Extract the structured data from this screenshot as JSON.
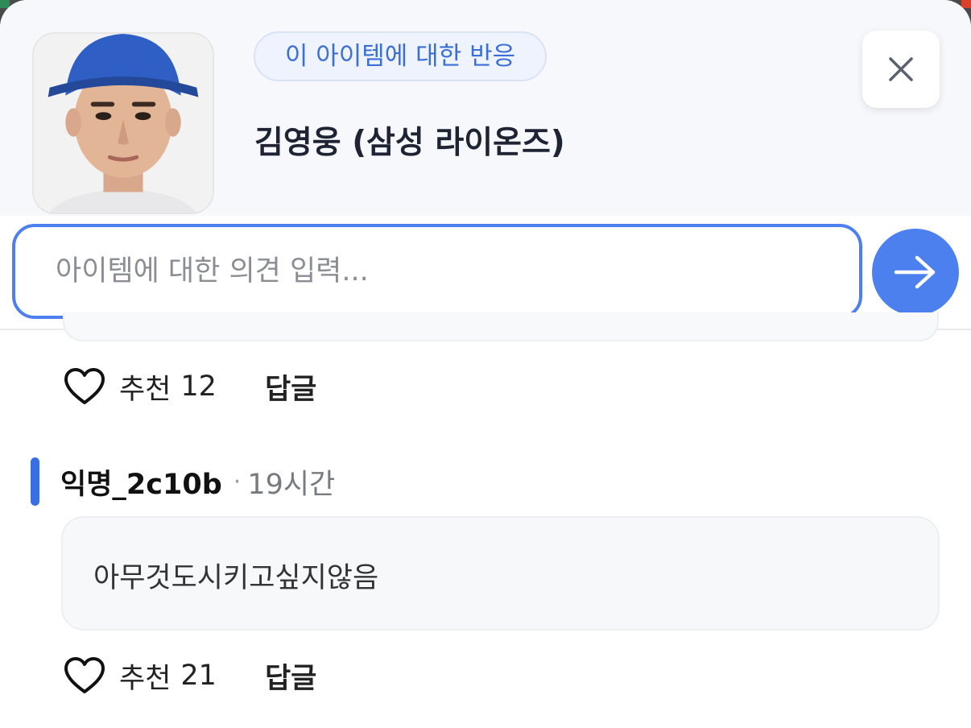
{
  "header": {
    "badge": "이 아이템에 대한 반응",
    "player_name": "김영웅 (삼성 라이온즈)",
    "avatar_alt": "player photo",
    "close_icon": "close-icon"
  },
  "composer": {
    "placeholder": "아이템에 대한 의견 입력...",
    "send_icon": "arrow-right-icon"
  },
  "comments": [
    {
      "like_label": "추천",
      "like_count": "12",
      "reply_label": "답글"
    },
    {
      "author": "익명_2c10b",
      "separator": "·",
      "time": "19시간",
      "body": "아무것도시키고싶지않음",
      "like_label": "추천",
      "like_count": "21",
      "reply_label": "답글"
    }
  ],
  "colors": {
    "accent": "#4d80ef",
    "badge_text": "#3b6fd8",
    "author_bar": "#3a6fe3"
  }
}
